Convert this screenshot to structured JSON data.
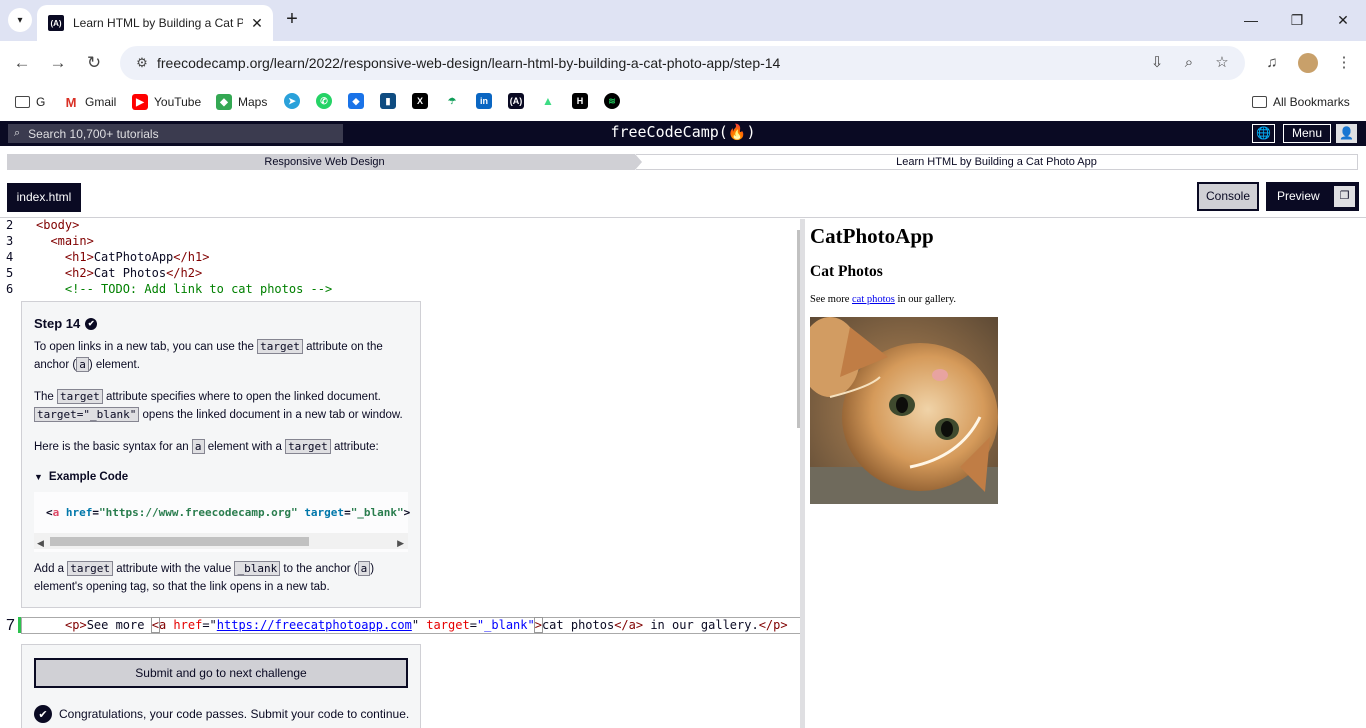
{
  "browser": {
    "tab_title": "Learn HTML by Building a Cat P",
    "favicon_text": "(A)",
    "url": "freecodecamp.org/learn/2022/responsive-web-design/learn-html-by-building-a-cat-photo-app/step-14",
    "bookmarks": [
      {
        "label": "G",
        "icon": "folder-icon"
      },
      {
        "label": "Gmail",
        "icon": "gmail-icon"
      },
      {
        "label": "YouTube",
        "icon": "youtube-icon"
      },
      {
        "label": "Maps",
        "icon": "maps-icon"
      }
    ],
    "bookmark_icons_only": [
      "telegram-icon",
      "whatsapp-icon",
      "bookmark-app-icon",
      "bookmark-app-icon",
      "x-icon",
      "bookmark-app-icon",
      "linkedin-icon",
      "freecodecamp-icon",
      "android-icon",
      "bookmark-app-icon",
      "spotify-icon"
    ],
    "all_bookmarks_label": "All Bookmarks"
  },
  "fcc": {
    "search_placeholder": "Search 10,700+ tutorials",
    "logo": "freeCodeCamp(🔥)",
    "menu_label": "Menu",
    "breadcrumb_superblock": "Responsive Web Design",
    "breadcrumb_block": "Learn HTML by Building a Cat Photo App",
    "file_tab": "index.html",
    "console_label": "Console",
    "preview_label": "Preview"
  },
  "editor": {
    "lines": [
      {
        "n": "2",
        "html": "<span class=\"tag\">&lt;body&gt;</span>"
      },
      {
        "n": "3",
        "html": "  <span class=\"tag\">&lt;main&gt;</span>"
      },
      {
        "n": "4",
        "html": "    <span class=\"tag\">&lt;h1&gt;</span><span class=\"plain\">CatPhotoApp</span><span class=\"tag\">&lt;/h1&gt;</span>"
      },
      {
        "n": "5",
        "html": "    <span class=\"tag\">&lt;h2&gt;</span><span class=\"plain\">Cat Photos</span><span class=\"tag\">&lt;/h2&gt;</span>"
      },
      {
        "n": "6",
        "html": "    <span class=\"comment\">&lt;!-- TODO: Add link to cat photos --&gt;</span>"
      }
    ],
    "active_line_number": "7",
    "active_line": {
      "p_open": "<p>",
      "text_before": "See more ",
      "a_open_bracket": "<",
      "a_tag": "a",
      "href_attr": "href",
      "href_value": "https://freecatphotoapp.com",
      "target_attr": "target",
      "target_value": "\"_blank\"",
      "close_bracket": ">",
      "link_text": "cat photos",
      "a_close": "</a>",
      "text_after": " in our gallery.",
      "p_close": "</p>"
    }
  },
  "step": {
    "title": "Step 14",
    "para1_a": "To open links in a new tab, you can use the ",
    "para1_code": "target",
    "para1_b": " attribute on the anchor (",
    "para1_code2": "a",
    "para1_c": ") element.",
    "para2_a": "The ",
    "para2_code": "target",
    "para2_b": " attribute specifies where to open the linked document. ",
    "para2_code2": "target=\"_blank\"",
    "para2_c": " opens the linked document in a new tab or window.",
    "para3_a": "Here is the basic syntax for an ",
    "para3_code": "a",
    "para3_b": " element with a ",
    "para3_code2": "target",
    "para3_c": " attribute:",
    "example_label": "Example Code",
    "example_code": "<a href=\"https://www.freecodecamp.org\" target=\"_blank\">",
    "para4_a": "Add a ",
    "para4_code": "target",
    "para4_b": " attribute with the value ",
    "para4_code2": "_blank",
    "para4_c": " to the anchor (",
    "para4_code3": "a",
    "para4_d": ") element's opening tag, so that the link opens in a new tab.",
    "submit_label": "Submit and go to next challenge",
    "congrats": "Congratulations, your code passes. Submit your code to continue."
  },
  "preview": {
    "h1": "CatPhotoApp",
    "h2": "Cat Photos",
    "p_before": "See more ",
    "p_link": "cat photos",
    "p_after": " in our gallery.",
    "image_alt": "cat lying on its back"
  },
  "colors": {
    "fcc_dark": "#0a0a23",
    "chrome_tabbar": "#dfe3f3",
    "gutter_active": "#2cc24e"
  }
}
